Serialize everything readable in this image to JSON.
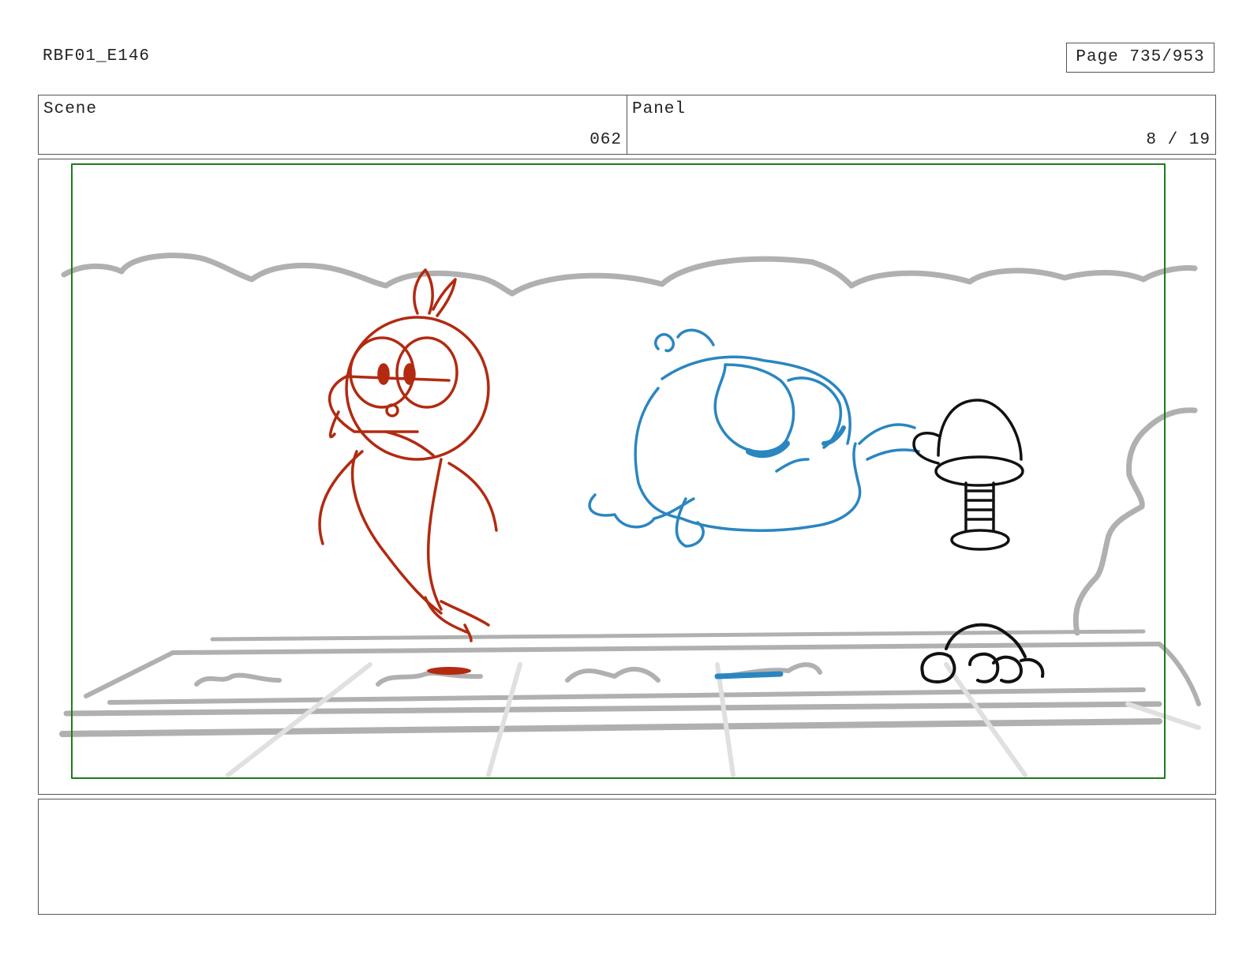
{
  "header": {
    "doc_id": "RBF01_E146",
    "page_label": "Page 735/953"
  },
  "info": {
    "scene_label": "Scene",
    "scene_value": "062",
    "panel_label": "Panel",
    "panel_value": "8 / 19"
  },
  "colors": {
    "safe_frame": "#1e7a1e",
    "red_character": "#b22a10",
    "blue_character": "#2a86c0",
    "background_sketch": "#b0b0b0",
    "ink": "#111111"
  },
  "notes": {
    "text": ""
  }
}
